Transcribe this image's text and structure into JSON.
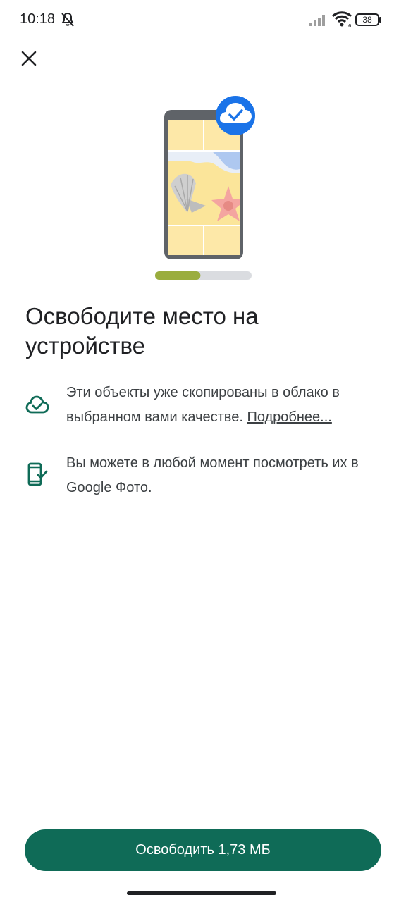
{
  "status_bar": {
    "time": "10:18",
    "battery_level": "38",
    "icons": [
      "mute-icon",
      "signal-icon",
      "wifi-icon",
      "battery-icon"
    ]
  },
  "toolbar": {
    "close_icon": "close-icon"
  },
  "illustration": {
    "progress": 0.47,
    "icons": [
      "phone-gallery-illustration",
      "cloud-check-badge-icon"
    ]
  },
  "title": "Освободите место на устройстве",
  "info": [
    {
      "icon": "cloud-check-icon",
      "text": "Эти объекты уже скопированы в облако в выбранном вами качестве.",
      "link": "Подробнее..."
    },
    {
      "icon": "phone-check-icon",
      "text": "Вы можете в любой момент посмотреть их в Google Фото."
    }
  ],
  "actions": {
    "free_label": "Освободить 1,73 МБ"
  },
  "colors": {
    "accent": "#0f6b57",
    "badge": "#1a73e8",
    "progress_fill": "#9aad3e",
    "progress_track": "#dadce0"
  }
}
